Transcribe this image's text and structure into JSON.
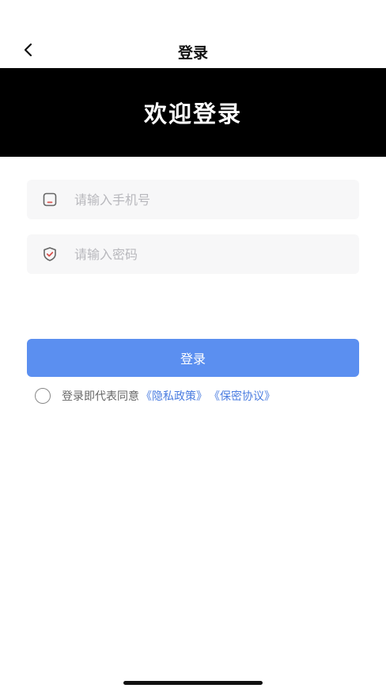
{
  "nav": {
    "title": "登录"
  },
  "banner": {
    "title": "欢迎登录"
  },
  "form": {
    "phone_placeholder": "请输入手机号",
    "password_placeholder": "请输入密码",
    "login_label": "登录"
  },
  "agreement": {
    "prefix": "登录即代表同意",
    "privacy_link": "《隐私政策》",
    "confidential_link": "《保密协议》"
  },
  "icons": {
    "back": "chevron-left-icon",
    "phone": "phone-icon",
    "password": "shield-icon"
  },
  "colors": {
    "accent": "#5b8ff0",
    "link": "#4a7ce0",
    "banner_bg": "#000000",
    "icon_red": "#d9534f"
  }
}
